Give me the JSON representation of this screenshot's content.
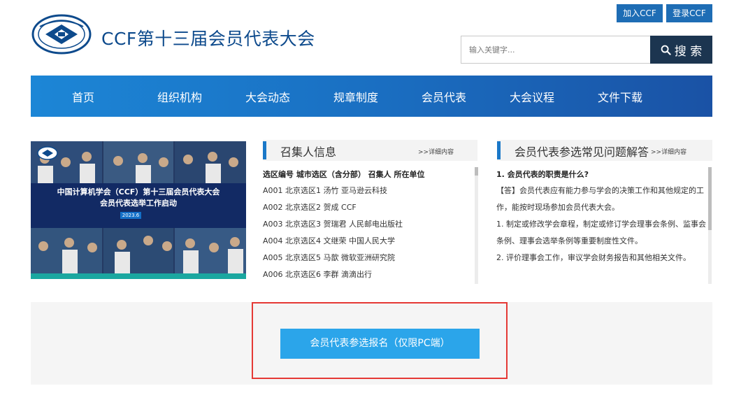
{
  "header": {
    "site_title": "CCF第十三届会员代表大会",
    "join_label": "加入CCF",
    "login_label": "登录CCF",
    "logo_text": "中国计算机学会 CCF",
    "search": {
      "placeholder": "输入关键字...",
      "button_label": "搜 索"
    }
  },
  "nav": {
    "items": [
      {
        "label": "首页"
      },
      {
        "label": "组织机构"
      },
      {
        "label": "大会动态"
      },
      {
        "label": "规章制度"
      },
      {
        "label": "会员代表"
      },
      {
        "label": "大会议程"
      },
      {
        "label": "文件下载"
      }
    ]
  },
  "banner": {
    "title_line1": "中国计算机学会（CCF）第十三届会员代表大会",
    "title_line2": "会员代表选举工作启动",
    "date": "2023.6"
  },
  "convener": {
    "title": "召集人信息",
    "more_label": ">>详细内容",
    "table_header": "选区编号 城市选区（含分部） 召集人 所在单位",
    "rows": [
      "A001 北京选区1 汤竹 亚马逊云科技",
      "A002 北京选区2 贺成 CCF",
      "A003 北京选区3 贺瑞君 人民邮电出版社",
      "A004 北京选区4 文继荣 中国人民大学",
      "A005 北京选区5 马歆 微软亚洲研究院",
      "A006 北京选区6 李群 滴滴出行"
    ]
  },
  "faq": {
    "title": "会员代表参选常见问题解答",
    "more_label": ">>详细内容",
    "question": "1. 会员代表的职责是什么?",
    "answers": [
      "【答】会员代表应有能力参与学会的决策工作和其他规定的工作，能按时现场参加会员代表大会。",
      "1. 制定或修改学会章程，制定或修订学会理事会条例、监事会条例、理事会选举条例等重要制度性文件。",
      "2. 评价理事会工作，审议学会财务报告和其他相关文件。"
    ]
  },
  "register": {
    "button_label": "会员代表参选报名（仅限PC端）"
  },
  "colors": {
    "brand_dark": "#0d4a8c",
    "nav_blue": "#1a6fc2",
    "search_btn": "#1c3550",
    "register_btn": "#2ba5ea",
    "highlight": "#e53935"
  }
}
